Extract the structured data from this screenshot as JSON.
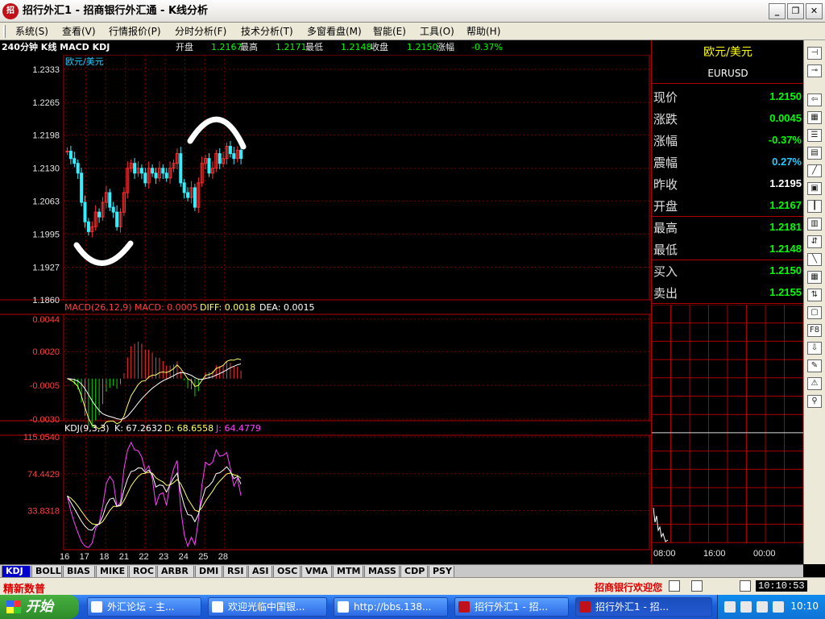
{
  "window": {
    "title": "招行外汇1 - 招商银行外汇通 - K线分析",
    "logo": "招",
    "buttons": [
      "_",
      "❐",
      "✕"
    ]
  },
  "menu": [
    "系统(S)",
    "查看(V)",
    "行情报价(P)",
    "分时分析(F)",
    "技术分析(T)",
    "多窗看盘(M)",
    "智能(E)",
    "工具(O)",
    "帮助(H)"
  ],
  "chart_header": {
    "period": "240分钟 K线 MACD KDJ",
    "open_label": "开盘",
    "open": "1.2167",
    "high_label": "最高",
    "high": "1.2171",
    "low_label": "最低",
    "low": "1.2148",
    "close_label": "收盘",
    "close": "1.2150",
    "change_label": "涨幅",
    "change": "-0.37%"
  },
  "symbol_label": "欧元/美元",
  "macd_header": {
    "name": "MACD(26,12,9)",
    "macd": "MACD: 0.0005",
    "diff": "DIFF: 0.0018",
    "dea": "DEA: 0.0015"
  },
  "kdj_header": {
    "name": "KDJ(9,3,3)",
    "k": "K: 67.2632",
    "d": "D: 68.6558",
    "j": "J: 64.4779"
  },
  "right_panel": {
    "name": "欧元/美元",
    "code": "EURUSD",
    "rows": [
      {
        "label": "现价",
        "value": "1.2150",
        "color": "#00ff00"
      },
      {
        "label": "涨跌",
        "value": "0.0045",
        "color": "#00ff00"
      },
      {
        "label": "涨幅",
        "value": "-0.37%",
        "color": "#00ff00"
      },
      {
        "label": "震幅",
        "value": "0.27%",
        "color": "#22ccff"
      },
      {
        "label": "昨收",
        "value": "1.2195",
        "color": "#ffffff"
      },
      {
        "label": "开盘",
        "value": "1.2167",
        "color": "#00ff00"
      },
      {
        "label": "最高",
        "value": "1.2181",
        "color": "#00ff00"
      },
      {
        "label": "最低",
        "value": "1.2148",
        "color": "#00ff00"
      },
      {
        "label": "买入",
        "value": "1.2150",
        "color": "#00ff00"
      },
      {
        "label": "卖出",
        "value": "1.2155",
        "color": "#00ff00"
      }
    ],
    "time_ticks": [
      "08:00",
      "16:00",
      "00:00"
    ]
  },
  "tabs": [
    "KDJ",
    "BOLL",
    "BIAS",
    "MIKE",
    "ROC",
    "ARBR",
    "DMI",
    "RSI",
    "ASI",
    "OSC",
    "VMA",
    "MTM",
    "MASS",
    "CDP",
    "PSY"
  ],
  "status": {
    "promo": "精新数普",
    "welcome": "招商银行欢迎您",
    "clock": "10:10:53"
  },
  "taskbar": {
    "start": "开始",
    "tasks": [
      "外汇论坛 - 主...",
      "欢迎光临中国银...",
      "http://bbs.138...",
      "招行外汇1 - 招...",
      "招行外汇1 - 招..."
    ],
    "time": "10:10"
  },
  "chart_data": [
    {
      "type": "candlestick",
      "title": "欧元/美元",
      "y_ticks": [
        "1.2333",
        "1.2265",
        "1.2198",
        "1.2130",
        "1.2063",
        "1.1995",
        "1.1927",
        "1.1860"
      ],
      "ylim": [
        1.186,
        1.2333
      ],
      "x_ticks": [
        "16",
        "17",
        "18",
        "21",
        "22",
        "23",
        "24",
        "25",
        "28"
      ],
      "closes": [
        1.2165,
        1.215,
        1.214,
        1.212,
        1.206,
        1.202,
        1.2,
        1.201,
        1.204,
        1.203,
        1.206,
        1.208,
        1.205,
        1.204,
        1.201,
        1.204,
        1.208,
        1.213,
        1.214,
        1.212,
        1.213,
        1.212,
        1.21,
        1.213,
        1.212,
        1.211,
        1.213,
        1.212,
        1.211,
        1.213,
        1.214,
        1.216,
        1.21,
        1.208,
        1.207,
        1.209,
        1.205,
        1.21,
        1.214,
        1.215,
        1.212,
        1.213,
        1.216,
        1.214,
        1.215,
        1.2175,
        1.216,
        1.215,
        1.2167,
        1.215
      ]
    },
    {
      "type": "bar+line",
      "title": "MACD(26,12,9)",
      "y_ticks": [
        "0.0044",
        "0.0020",
        "-0.0005",
        "-0.0030"
      ],
      "ylim": [
        -0.003,
        0.0044
      ]
    },
    {
      "type": "line",
      "title": "KDJ(9,3,3)",
      "y_ticks": [
        "115.0540",
        "74.4429",
        "33.8318"
      ]
    }
  ]
}
